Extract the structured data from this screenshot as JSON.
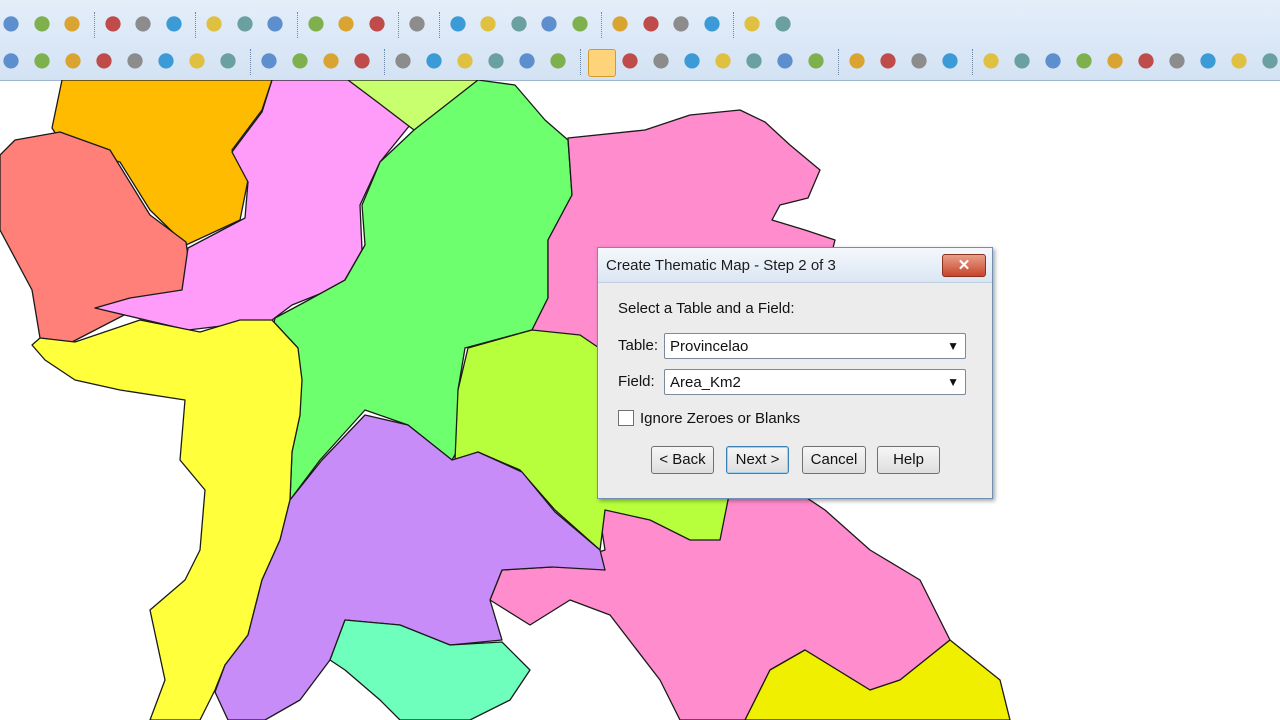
{
  "colors": {
    "toolbar_bg": "#dbe7f5",
    "dialog_bg": "#ececec",
    "region_orange": "#ffbb00",
    "region_salmon": "#ff7f79",
    "region_magenta": "#ff9cf9",
    "region_lime_top": "#c8ff6e",
    "region_green": "#6dff6d",
    "region_pink": "#ff8ccc",
    "region_lime": "#b7ff3d",
    "region_yellow": "#ffff3b",
    "region_purple": "#c88cf9",
    "region_aqua": "#6dffbb",
    "region_gold": "#f0ef00"
  },
  "toolbar_icons": {
    "row1": [
      "open-icon",
      "new-icon",
      "find-icon",
      "save-icon",
      "save-copy-icon",
      "open-workspace-icon",
      "copy-icon",
      "print-icon",
      "export-pdf-icon",
      "cut-icon",
      "copy-doc-icon",
      "paste-icon",
      "undo-icon",
      "browser-icon",
      "map-window-icon",
      "graph-icon",
      "layout-icon",
      "redistrict-icon",
      "globe-icon",
      "chart-icon",
      "stats-icon",
      "shield-icon",
      "hotlink-icon",
      "comment-icon"
    ],
    "row2": [
      "ellipse-icon",
      "circle-icon",
      "rectangle-icon",
      "rounded-rect-icon",
      "text-icon",
      "frame-icon",
      "polygon-icon",
      "polyline-icon",
      "symbol-icon",
      "line-icon",
      "arc-icon",
      "text-style-icon",
      "layer-icon",
      "reshape-icon",
      "add-node-icon",
      "combine-icon",
      "convert-icon",
      "drag-icon",
      "select-icon",
      "marquee-select-icon",
      "radius-select-icon",
      "polygon-select-icon",
      "boundary-select-icon",
      "unselect-icon",
      "invert-icon",
      "graph-select-icon",
      "zoom-in-icon",
      "zoom-out-icon",
      "change-view-icon",
      "grabber-icon",
      "info-icon",
      "label-icon",
      "ruler-icon",
      "drag-window-icon",
      "layer-control-icon",
      "measure-icon",
      "legend-icon",
      "sum-icon",
      "options-icon",
      "more-icon"
    ]
  },
  "dialog": {
    "title": "Create Thematic Map - Step 2 of 3",
    "close_glyph": "✕",
    "prompt": "Select a Table and a Field:",
    "table_label": "Table:",
    "table_value": "Provincelao",
    "field_label": "Field:",
    "field_value": "Area_Km2",
    "ignore_label": "Ignore Zeroes or Blanks",
    "ignore_checked": false,
    "back_label": "< Back",
    "next_label": "Next >",
    "cancel_label": "Cancel",
    "help_label": "Help",
    "dropdown_glyph": "▼"
  }
}
